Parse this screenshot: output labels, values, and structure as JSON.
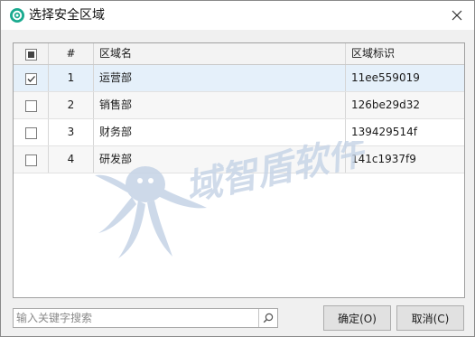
{
  "window": {
    "title": "选择安全区域",
    "icons": {
      "app": "app-logo-icon",
      "close": "close-icon"
    }
  },
  "table": {
    "columns": [
      "",
      "#",
      "区域名",
      "区域标识"
    ],
    "rows": [
      {
        "checked": true,
        "num": "1",
        "name": "运营部",
        "id": "11ee559019"
      },
      {
        "checked": false,
        "num": "2",
        "name": "销售部",
        "id": "126be29d32"
      },
      {
        "checked": false,
        "num": "3",
        "name": "财务部",
        "id": "139429514f"
      },
      {
        "checked": false,
        "num": "4",
        "name": "研发部",
        "id": "141c1937f9"
      }
    ],
    "header_checkbox": "partial",
    "selected_row_color": "#e5f0fa"
  },
  "watermark": {
    "text": "域智盾软件"
  },
  "search": {
    "placeholder": "输入关键字搜索",
    "value": "",
    "icon": "search-icon"
  },
  "buttons": {
    "ok": "确定(O)",
    "cancel": "取消(C)"
  },
  "colors": {
    "accent": "#1aaa8f",
    "watermark": "#c5d3e6"
  }
}
